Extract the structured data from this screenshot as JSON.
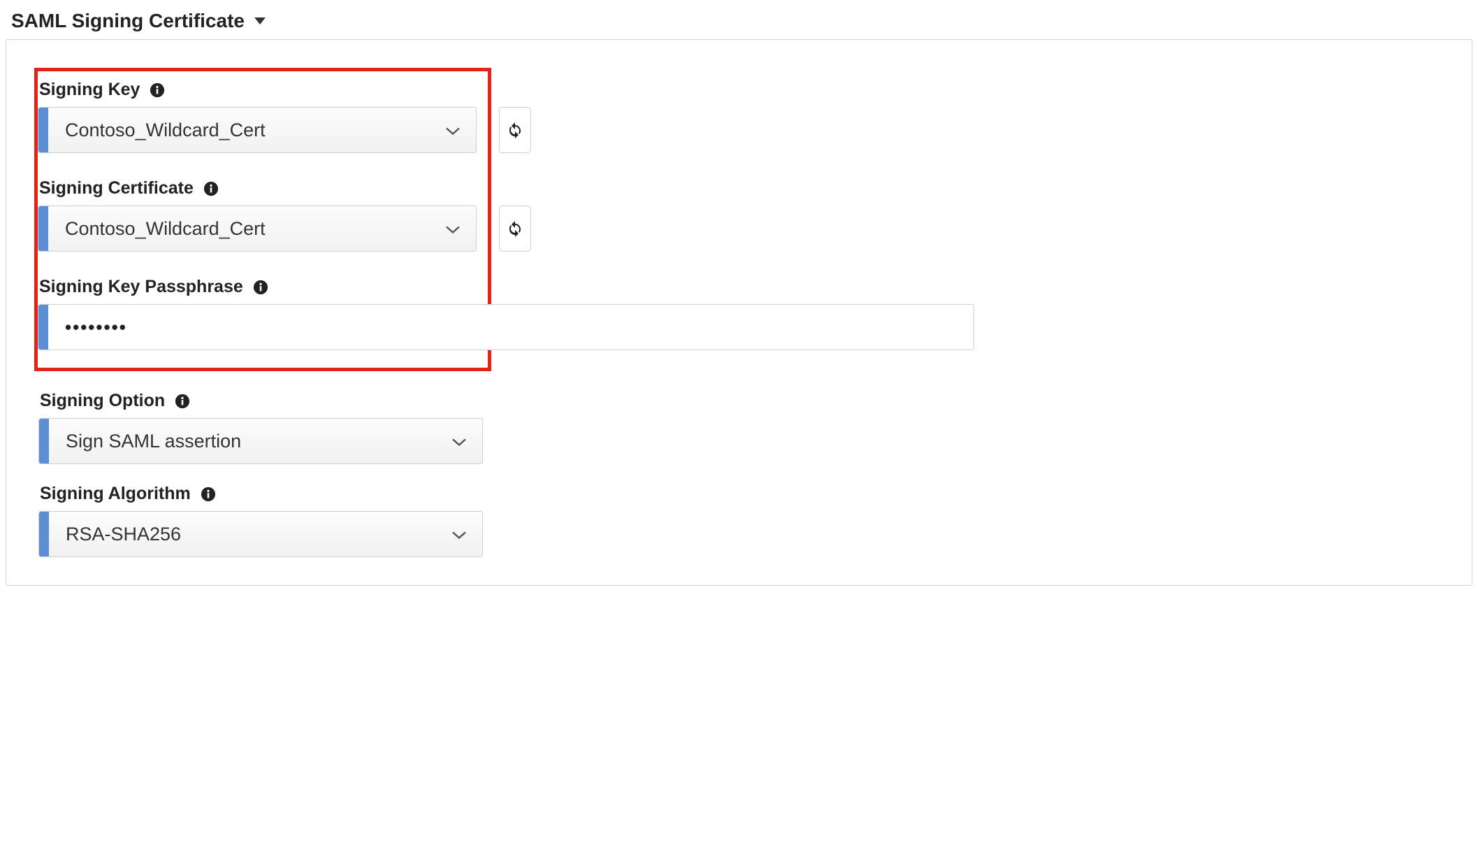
{
  "section": {
    "title": "SAML Signing Certificate"
  },
  "fields": {
    "signing_key": {
      "label": "Signing Key",
      "value": "Contoso_Wildcard_Cert"
    },
    "signing_certificate": {
      "label": "Signing Certificate",
      "value": "Contoso_Wildcard_Cert"
    },
    "signing_key_passphrase": {
      "label": "Signing Key Passphrase",
      "value": "••••••••"
    },
    "signing_option": {
      "label": "Signing Option",
      "value": "Sign SAML assertion"
    },
    "signing_algorithm": {
      "label": "Signing Algorithm",
      "value": "RSA-SHA256"
    }
  }
}
